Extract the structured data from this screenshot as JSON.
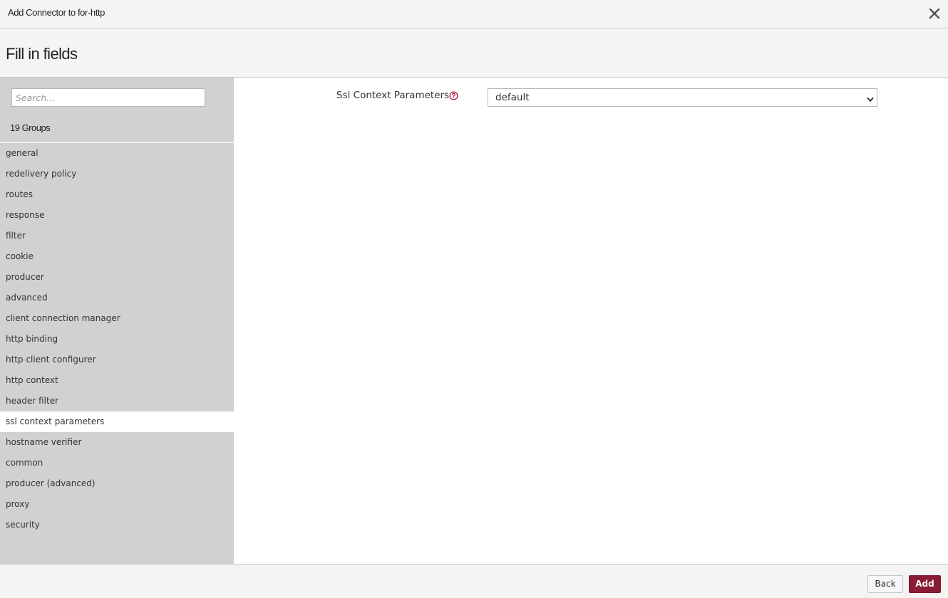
{
  "window": {
    "title": "Add Connector to for-http",
    "close_icon": "close-icon"
  },
  "heading": {
    "title": "Fill in fields"
  },
  "sidebar": {
    "search_placeholder": "Search...",
    "group_count": "19 Groups",
    "groups": [
      "general",
      "redelivery policy",
      "routes",
      "response",
      "filter",
      "cookie",
      "producer",
      "advanced",
      "client connection manager",
      "http binding",
      "http client configurer",
      "http context",
      "header filter",
      "ssl context parameters",
      "hostname verifier",
      "common",
      "producer (advanced)",
      "proxy",
      "security"
    ],
    "selected_group": "ssl context parameters"
  },
  "form": {
    "field_label": "Ssl Context Parameters",
    "help_icon": "question-circle-icon",
    "select_value": "default"
  },
  "footer": {
    "back_label": "Back",
    "add_label": "Add"
  },
  "colors": {
    "accent": "#8a1c36",
    "sidebar_bg": "#d1d1d1",
    "header_bg": "#f4f4f4"
  }
}
